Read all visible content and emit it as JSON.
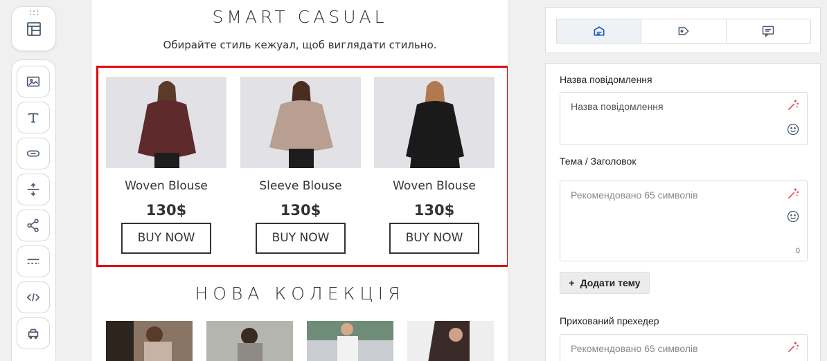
{
  "canvas": {
    "section1_title": "SMART CASUAL",
    "section1_subtitle": "Обирайте стиль кежуал, щоб виглядати стильно.",
    "products": [
      {
        "name": "Woven Blouse",
        "price": "130$",
        "button": "BUY NOW",
        "color": "#5e2a2c"
      },
      {
        "name": "Sleeve Blouse",
        "price": "130$",
        "button": "BUY NOW",
        "color": "#b89f92"
      },
      {
        "name": "Woven Blouse",
        "price": "130$",
        "button": "BUY NOW",
        "color": "#1a1a1a"
      }
    ],
    "section2_title": "НОВА КОЛЕКЦІЯ"
  },
  "sidebar": {
    "tools": [
      "image-icon",
      "text-icon",
      "button-icon",
      "spacer-icon",
      "share-icon",
      "divider-icon",
      "code-icon",
      "product-icon"
    ]
  },
  "panel": {
    "tabs": [
      "settings-icon",
      "tag-icon",
      "comment-icon"
    ],
    "message_name_label": "Назва повідомлення",
    "message_name_placeholder": "Назва повідомлення",
    "subject_label": "Тема / Заголовок",
    "subject_placeholder": "Рекомендовано 65 символів",
    "subject_count": "0",
    "add_subject_label": "Додати тему",
    "preheader_label": "Прихований прехедер",
    "preheader_placeholder": "Рекомендовано 65 символів"
  },
  "colors": {
    "accent": "#e3050c",
    "icon": "#4a5a70",
    "tab_active": "#1e5bb8",
    "wand": "#e8455a"
  }
}
